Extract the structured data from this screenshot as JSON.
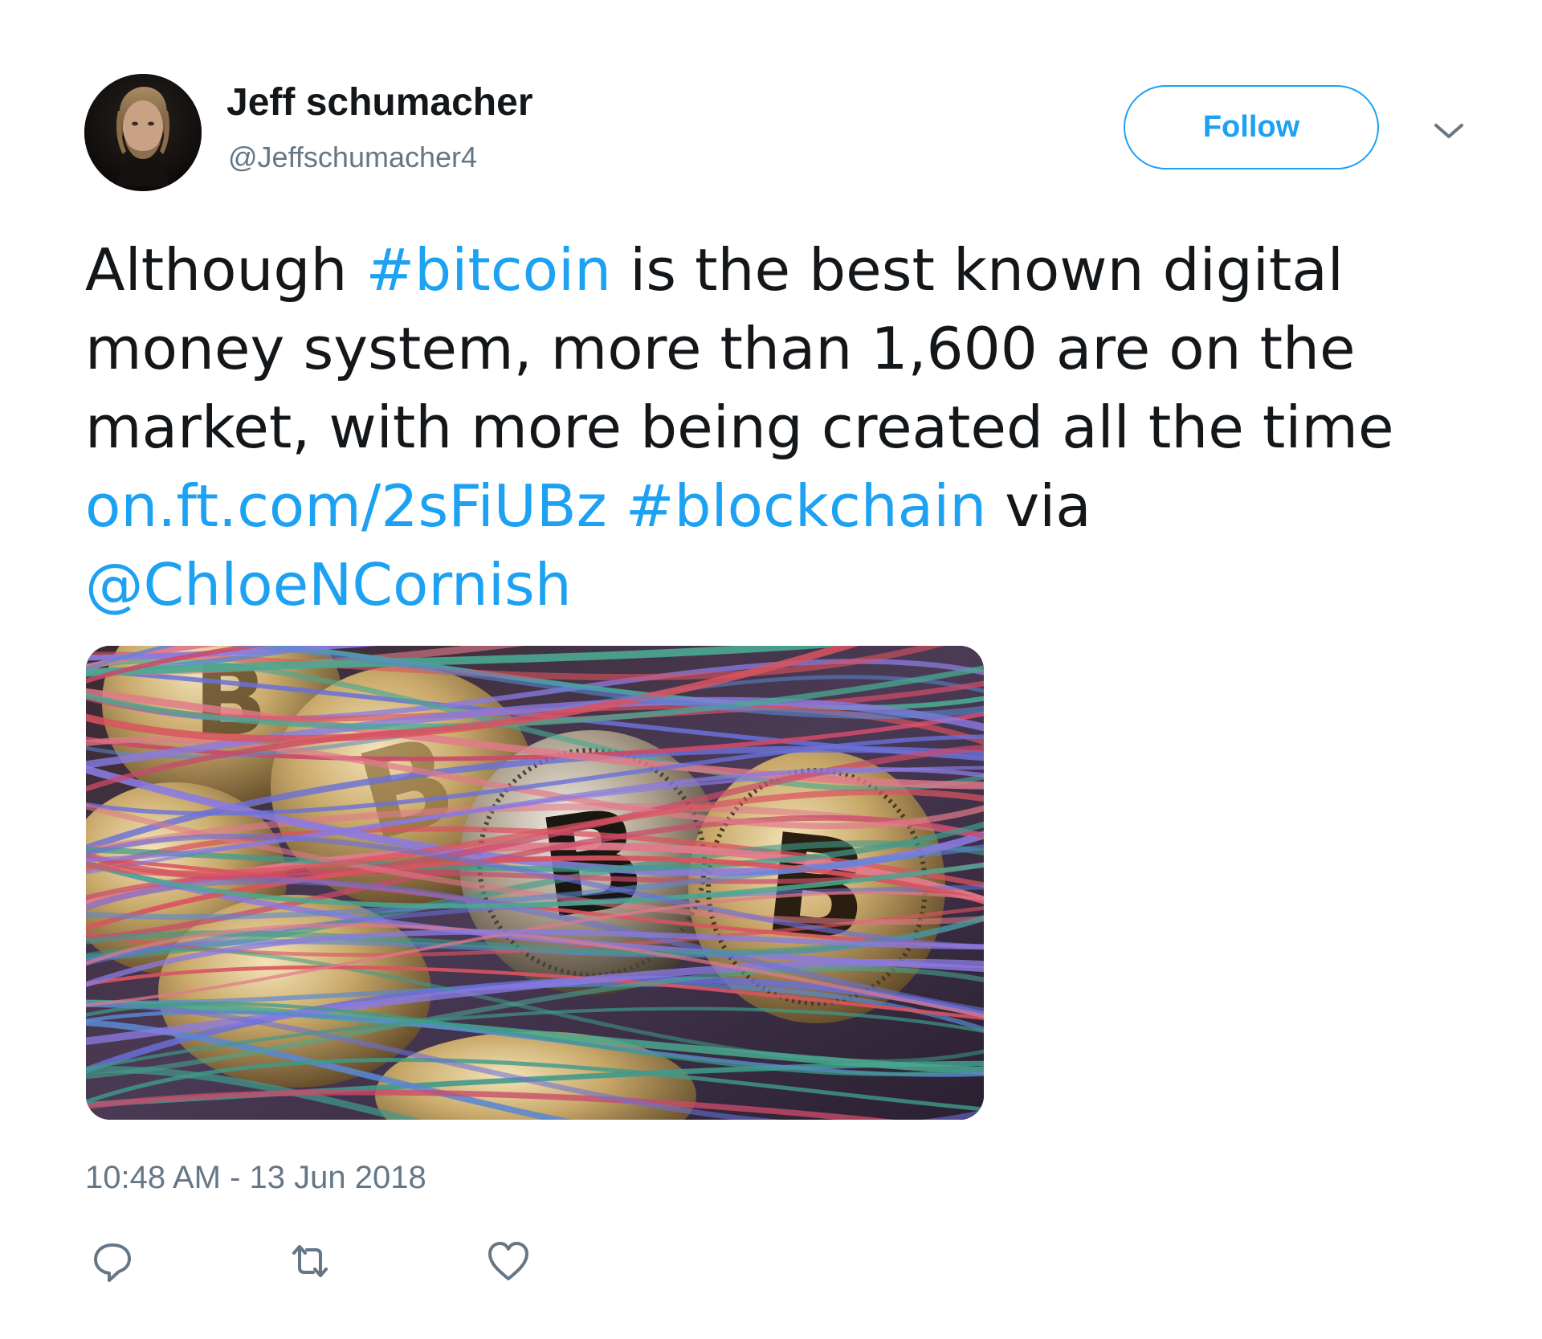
{
  "author": {
    "display_name": "Jeff schumacher",
    "handle": "@Jeffschumacher4"
  },
  "header": {
    "follow_label": "Follow",
    "menu_icon": "chevron-down-icon"
  },
  "tweet": {
    "lines": [
      [
        {
          "text": "Although ",
          "link": false
        },
        {
          "text": "#bitcoin",
          "link": true
        },
        {
          "text": " is the best known digital",
          "link": false
        }
      ],
      [
        {
          "text": "money system, more than 1,600 are on the",
          "link": false
        }
      ],
      [
        {
          "text": "market, with more being created all the time",
          "link": false
        }
      ],
      [
        {
          "text": "on.ft.com/2sFiUBz",
          "link": true
        },
        {
          "text": " ",
          "link": false
        },
        {
          "text": "#blockchain",
          "link": true
        },
        {
          "text": " via",
          "link": false
        }
      ],
      [
        {
          "text": "@ChloeNCornish",
          "link": true
        }
      ]
    ],
    "timestamp": "10:48 AM - 13 Jun 2018"
  },
  "actions": [
    {
      "name": "reply",
      "icon": "reply-icon"
    },
    {
      "name": "retweet",
      "icon": "retweet-icon"
    },
    {
      "name": "like",
      "icon": "heart-icon"
    }
  ],
  "colors": {
    "link": "#1da1f2",
    "text": "#14171a",
    "secondary": "#657786"
  }
}
